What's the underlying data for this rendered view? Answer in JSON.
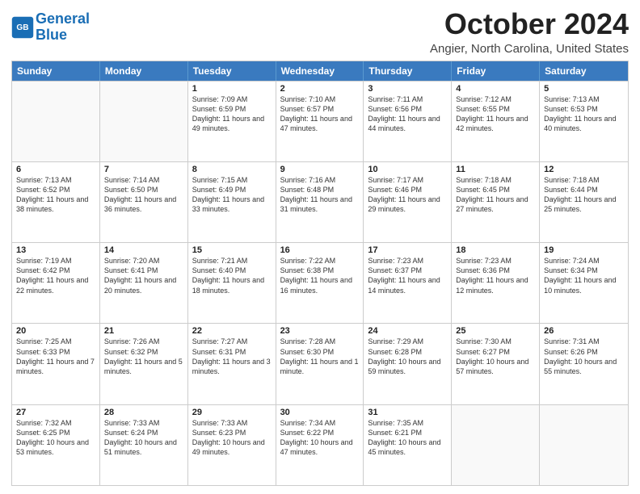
{
  "logo": {
    "line1": "General",
    "line2": "Blue"
  },
  "title": "October 2024",
  "location": "Angier, North Carolina, United States",
  "days": [
    "Sunday",
    "Monday",
    "Tuesday",
    "Wednesday",
    "Thursday",
    "Friday",
    "Saturday"
  ],
  "weeks": [
    [
      {
        "day": "",
        "empty": true
      },
      {
        "day": "",
        "empty": true
      },
      {
        "day": "1",
        "sunrise": "Sunrise: 7:09 AM",
        "sunset": "Sunset: 6:59 PM",
        "daylight": "Daylight: 11 hours and 49 minutes."
      },
      {
        "day": "2",
        "sunrise": "Sunrise: 7:10 AM",
        "sunset": "Sunset: 6:57 PM",
        "daylight": "Daylight: 11 hours and 47 minutes."
      },
      {
        "day": "3",
        "sunrise": "Sunrise: 7:11 AM",
        "sunset": "Sunset: 6:56 PM",
        "daylight": "Daylight: 11 hours and 44 minutes."
      },
      {
        "day": "4",
        "sunrise": "Sunrise: 7:12 AM",
        "sunset": "Sunset: 6:55 PM",
        "daylight": "Daylight: 11 hours and 42 minutes."
      },
      {
        "day": "5",
        "sunrise": "Sunrise: 7:13 AM",
        "sunset": "Sunset: 6:53 PM",
        "daylight": "Daylight: 11 hours and 40 minutes."
      }
    ],
    [
      {
        "day": "6",
        "sunrise": "Sunrise: 7:13 AM",
        "sunset": "Sunset: 6:52 PM",
        "daylight": "Daylight: 11 hours and 38 minutes."
      },
      {
        "day": "7",
        "sunrise": "Sunrise: 7:14 AM",
        "sunset": "Sunset: 6:50 PM",
        "daylight": "Daylight: 11 hours and 36 minutes."
      },
      {
        "day": "8",
        "sunrise": "Sunrise: 7:15 AM",
        "sunset": "Sunset: 6:49 PM",
        "daylight": "Daylight: 11 hours and 33 minutes."
      },
      {
        "day": "9",
        "sunrise": "Sunrise: 7:16 AM",
        "sunset": "Sunset: 6:48 PM",
        "daylight": "Daylight: 11 hours and 31 minutes."
      },
      {
        "day": "10",
        "sunrise": "Sunrise: 7:17 AM",
        "sunset": "Sunset: 6:46 PM",
        "daylight": "Daylight: 11 hours and 29 minutes."
      },
      {
        "day": "11",
        "sunrise": "Sunrise: 7:18 AM",
        "sunset": "Sunset: 6:45 PM",
        "daylight": "Daylight: 11 hours and 27 minutes."
      },
      {
        "day": "12",
        "sunrise": "Sunrise: 7:18 AM",
        "sunset": "Sunset: 6:44 PM",
        "daylight": "Daylight: 11 hours and 25 minutes."
      }
    ],
    [
      {
        "day": "13",
        "sunrise": "Sunrise: 7:19 AM",
        "sunset": "Sunset: 6:42 PM",
        "daylight": "Daylight: 11 hours and 22 minutes."
      },
      {
        "day": "14",
        "sunrise": "Sunrise: 7:20 AM",
        "sunset": "Sunset: 6:41 PM",
        "daylight": "Daylight: 11 hours and 20 minutes."
      },
      {
        "day": "15",
        "sunrise": "Sunrise: 7:21 AM",
        "sunset": "Sunset: 6:40 PM",
        "daylight": "Daylight: 11 hours and 18 minutes."
      },
      {
        "day": "16",
        "sunrise": "Sunrise: 7:22 AM",
        "sunset": "Sunset: 6:38 PM",
        "daylight": "Daylight: 11 hours and 16 minutes."
      },
      {
        "day": "17",
        "sunrise": "Sunrise: 7:23 AM",
        "sunset": "Sunset: 6:37 PM",
        "daylight": "Daylight: 11 hours and 14 minutes."
      },
      {
        "day": "18",
        "sunrise": "Sunrise: 7:23 AM",
        "sunset": "Sunset: 6:36 PM",
        "daylight": "Daylight: 11 hours and 12 minutes."
      },
      {
        "day": "19",
        "sunrise": "Sunrise: 7:24 AM",
        "sunset": "Sunset: 6:34 PM",
        "daylight": "Daylight: 11 hours and 10 minutes."
      }
    ],
    [
      {
        "day": "20",
        "sunrise": "Sunrise: 7:25 AM",
        "sunset": "Sunset: 6:33 PM",
        "daylight": "Daylight: 11 hours and 7 minutes."
      },
      {
        "day": "21",
        "sunrise": "Sunrise: 7:26 AM",
        "sunset": "Sunset: 6:32 PM",
        "daylight": "Daylight: 11 hours and 5 minutes."
      },
      {
        "day": "22",
        "sunrise": "Sunrise: 7:27 AM",
        "sunset": "Sunset: 6:31 PM",
        "daylight": "Daylight: 11 hours and 3 minutes."
      },
      {
        "day": "23",
        "sunrise": "Sunrise: 7:28 AM",
        "sunset": "Sunset: 6:30 PM",
        "daylight": "Daylight: 11 hours and 1 minute."
      },
      {
        "day": "24",
        "sunrise": "Sunrise: 7:29 AM",
        "sunset": "Sunset: 6:28 PM",
        "daylight": "Daylight: 10 hours and 59 minutes."
      },
      {
        "day": "25",
        "sunrise": "Sunrise: 7:30 AM",
        "sunset": "Sunset: 6:27 PM",
        "daylight": "Daylight: 10 hours and 57 minutes."
      },
      {
        "day": "26",
        "sunrise": "Sunrise: 7:31 AM",
        "sunset": "Sunset: 6:26 PM",
        "daylight": "Daylight: 10 hours and 55 minutes."
      }
    ],
    [
      {
        "day": "27",
        "sunrise": "Sunrise: 7:32 AM",
        "sunset": "Sunset: 6:25 PM",
        "daylight": "Daylight: 10 hours and 53 minutes."
      },
      {
        "day": "28",
        "sunrise": "Sunrise: 7:33 AM",
        "sunset": "Sunset: 6:24 PM",
        "daylight": "Daylight: 10 hours and 51 minutes."
      },
      {
        "day": "29",
        "sunrise": "Sunrise: 7:33 AM",
        "sunset": "Sunset: 6:23 PM",
        "daylight": "Daylight: 10 hours and 49 minutes."
      },
      {
        "day": "30",
        "sunrise": "Sunrise: 7:34 AM",
        "sunset": "Sunset: 6:22 PM",
        "daylight": "Daylight: 10 hours and 47 minutes."
      },
      {
        "day": "31",
        "sunrise": "Sunrise: 7:35 AM",
        "sunset": "Sunset: 6:21 PM",
        "daylight": "Daylight: 10 hours and 45 minutes."
      },
      {
        "day": "",
        "empty": true
      },
      {
        "day": "",
        "empty": true
      }
    ]
  ]
}
